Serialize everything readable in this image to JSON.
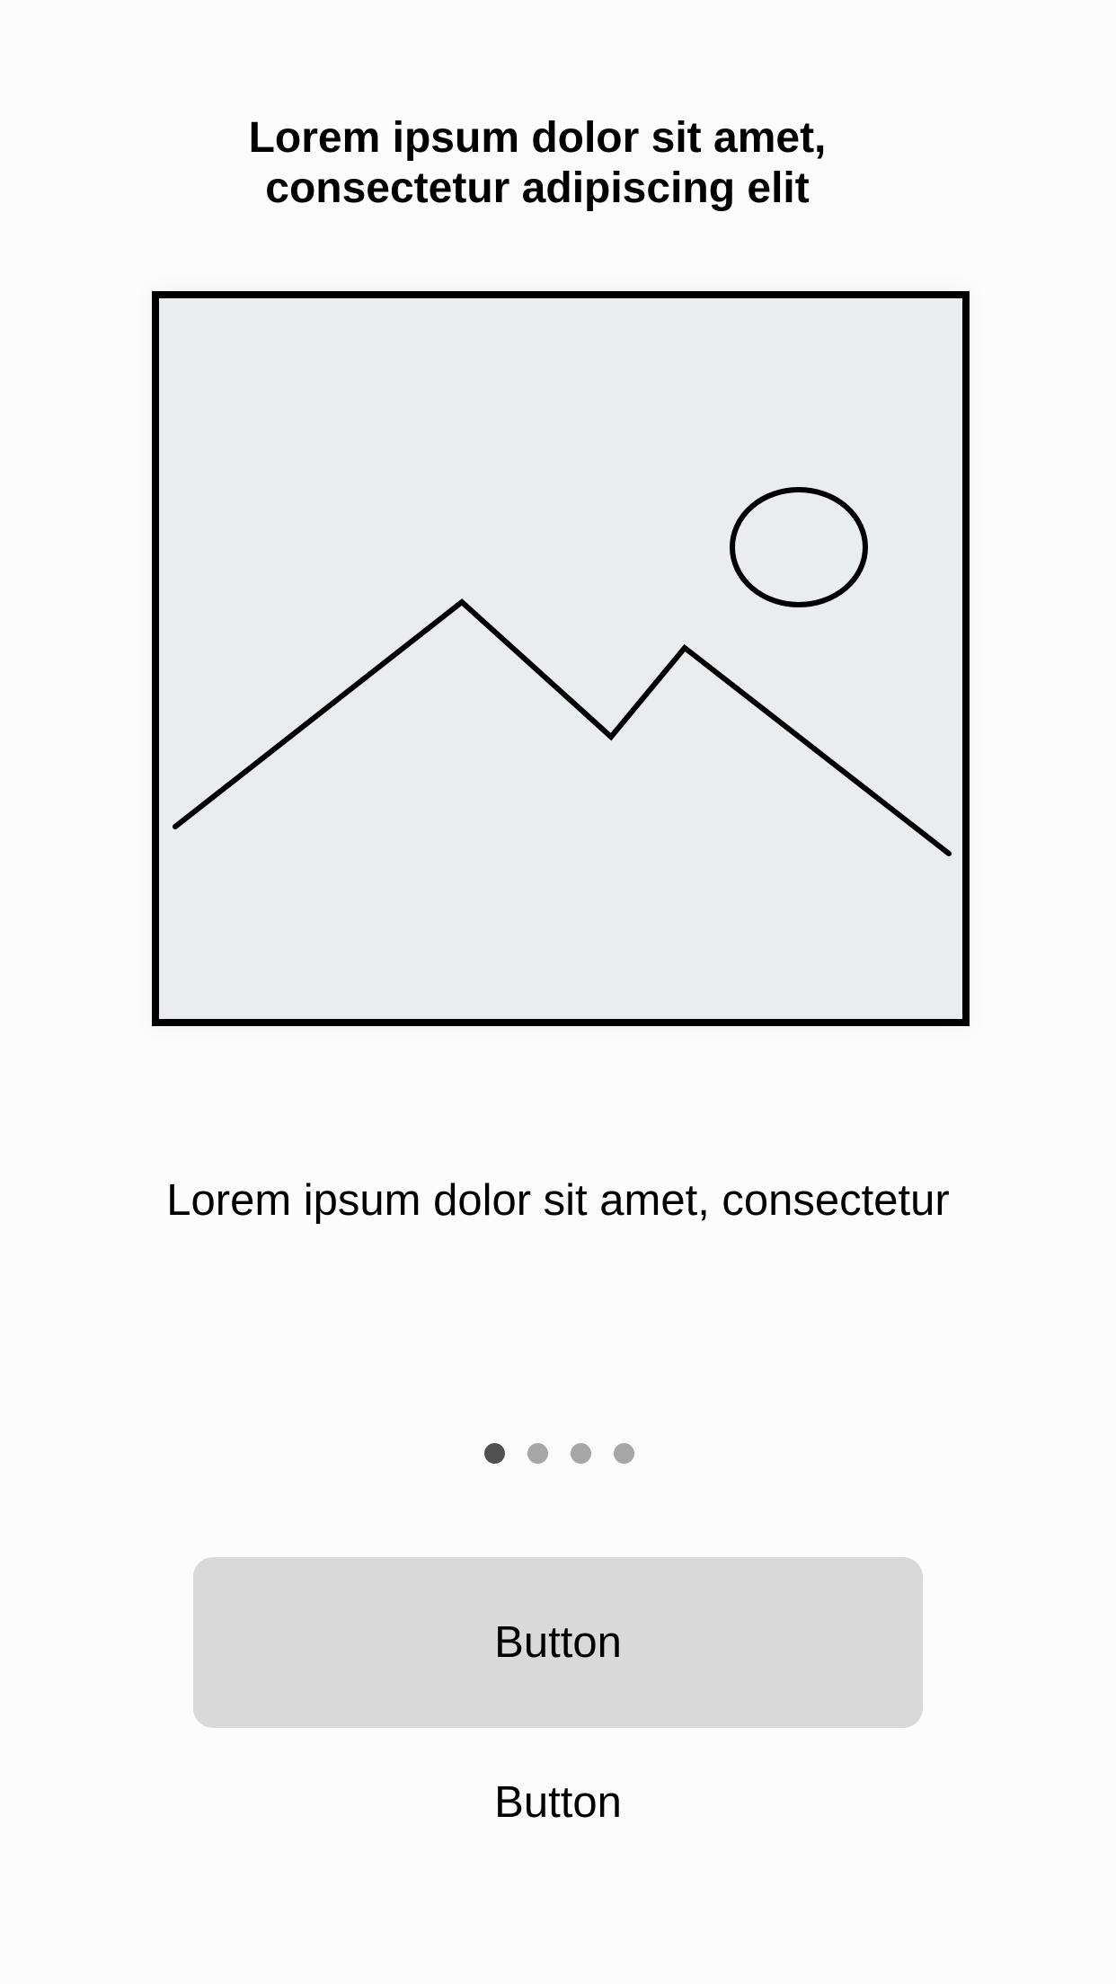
{
  "title": {
    "line1": "Lorem ipsum dolor sit amet,",
    "line2": "consectetur adipiscing elit"
  },
  "image": {
    "icon": "image-placeholder-icon",
    "frame_color": "#000000",
    "fill_color": "#e9edee"
  },
  "subtitle": "Lorem ipsum dolor sit amet, consectetur",
  "pager": {
    "count": 4,
    "active_index": 0,
    "active_color": "#505050",
    "inactive_color": "#a6a6a6"
  },
  "primary_button": {
    "label": "Button",
    "background": "#d9d9d9"
  },
  "secondary_button": {
    "label": "Button"
  }
}
